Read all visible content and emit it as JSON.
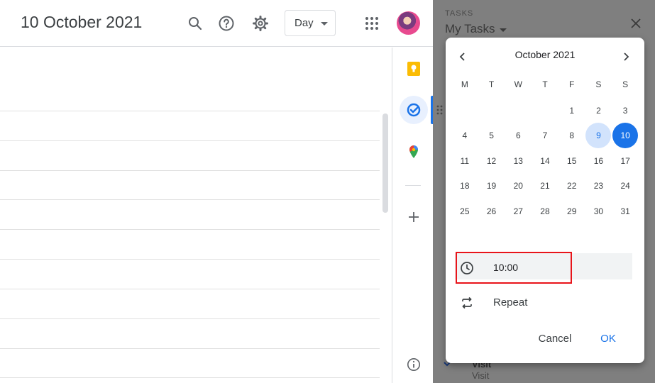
{
  "header": {
    "date_title": "10 October 2021",
    "view_selector": "Day",
    "icons": [
      "search-icon",
      "help-icon",
      "settings-icon",
      "apps-grid-icon"
    ]
  },
  "side_rail": {
    "icons": [
      "keep-icon",
      "tasks-icon",
      "maps-icon",
      "add-icon",
      "info-icon"
    ]
  },
  "tasks_panel": {
    "section_label": "TASKS",
    "list_name": "My Tasks",
    "task": {
      "title": "Visit",
      "subtitle": "Visit"
    }
  },
  "date_picker": {
    "month_title": "October 2021",
    "weekdays": [
      "M",
      "T",
      "W",
      "T",
      "F",
      "S",
      "S"
    ],
    "leading_blanks": 4,
    "days": [
      1,
      2,
      3,
      4,
      5,
      6,
      7,
      8,
      9,
      10,
      11,
      12,
      13,
      14,
      15,
      16,
      17,
      18,
      19,
      20,
      21,
      22,
      23,
      24,
      25,
      26,
      27,
      28,
      29,
      30,
      31
    ],
    "today": 9,
    "selected": 10
  },
  "time_field": {
    "value": "10:00"
  },
  "repeat": {
    "label": "Repeat"
  },
  "actions": {
    "cancel_label": "Cancel",
    "ok_label": "OK"
  },
  "colors": {
    "accent": "#1a73e8",
    "today_bg": "#d2e3fc",
    "highlight": "#e8141a",
    "overlay": "#7f7f7f"
  }
}
